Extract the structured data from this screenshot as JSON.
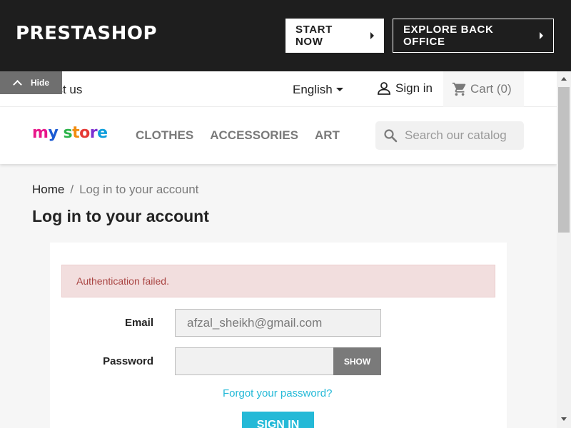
{
  "demo_bar": {
    "logo": "PRESTASHOP",
    "start_now": "START NOW",
    "explore_back_office": "EXPLORE BACK OFFICE",
    "hide_label": "Hide"
  },
  "header_nav": {
    "contact": "act us",
    "language": "English",
    "sign_in": "Sign in",
    "cart": "Cart (0)"
  },
  "logo": {
    "my": "my",
    "store": "store",
    "colors": [
      "#e8178a",
      "#1b5bd3",
      "#2cb34a",
      "#f28c0f",
      "#e53935",
      "#7b2fd1",
      "#0d9ddb"
    ]
  },
  "menu": [
    "CLOTHES",
    "ACCESSORIES",
    "ART"
  ],
  "search": {
    "placeholder": "Search our catalog"
  },
  "breadcrumb": {
    "home": "Home",
    "separator": "/",
    "current": "Log in to your account"
  },
  "page_title": "Log in to your account",
  "login": {
    "alert": "Authentication failed.",
    "email_label": "Email",
    "email_value": "afzal_sheikh@gmail.com",
    "password_label": "Password",
    "show_button": "SHOW",
    "forgot_link": "Forgot your password?",
    "sign_in_button": "SIGN IN"
  },
  "colors": {
    "accent": "#24b9d7",
    "alert_bg": "#f2dede",
    "alert_text": "#a94442",
    "top_bar": "#1e1e1e"
  }
}
